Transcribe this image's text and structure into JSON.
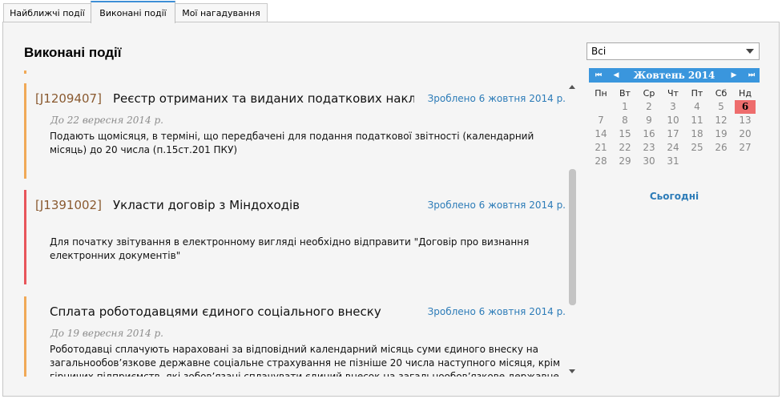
{
  "tabs": [
    {
      "label": "Найближчі події"
    },
    {
      "label": "Виконані події"
    },
    {
      "label": "Мої нагадування"
    }
  ],
  "page_title": "Виконані події",
  "events": [
    {
      "code": "[J1209407]",
      "title": "Реєстр отриманих та виданих податкових накладних",
      "done": "Зроблено 6 жовтня 2014 р.",
      "deadline": "До 22 вересня 2014 р.",
      "description": "Подають щомісяця, в терміні, що передбачені для подання податкової звітності (календарний місяць) до 20 числа (п.15ст.201 ПКУ)",
      "color": "#f0a957"
    },
    {
      "code": "[J1391002]",
      "title": "Укласти договір з Міндоходів",
      "done": "Зроблено 6 жовтня 2014 р.",
      "deadline": "",
      "description": "Для початку звітування в електронному вигляді необхідно відправити \"Договір про визнання електронних документів\"",
      "color": "#e8555b"
    },
    {
      "code": "",
      "title": "Сплата роботодавцями єдиного соціального внеску",
      "done": "Зроблено 6 жовтня 2014 р.",
      "deadline": "До 19 вересня 2014 р.",
      "description": "Роботодавці сплачують нараховані за відповідний календарний місяць суми єдиного внеску на загальнообов’язкове державне соціальне страхування не пізніше 20 числа наступного місяця, крім гірничих підприємств, які зобов’язані сплачувати єдиний внесок на загальнообов’язкове державне",
      "color": "#f0a957"
    }
  ],
  "filter": {
    "selected": "Всі"
  },
  "calendar": {
    "nav_first": "⏮",
    "nav_prev": "◀",
    "nav_next": "▶",
    "nav_last": "⏭",
    "month_label": "Жовтень 2014",
    "weekdays": [
      "Пн",
      "Вт",
      "Ср",
      "Чт",
      "Пт",
      "Сб",
      "Нд"
    ],
    "leading_blank": 1,
    "days": [
      "1",
      "2",
      "3",
      "4",
      "5",
      "6",
      "7",
      "8",
      "9",
      "10",
      "11",
      "12",
      "13",
      "14",
      "15",
      "16",
      "17",
      "18",
      "19",
      "20",
      "21",
      "22",
      "23",
      "24",
      "25",
      "26",
      "27",
      "28",
      "29",
      "30",
      "31"
    ],
    "today": "6",
    "today_link": "Сьогодні"
  }
}
